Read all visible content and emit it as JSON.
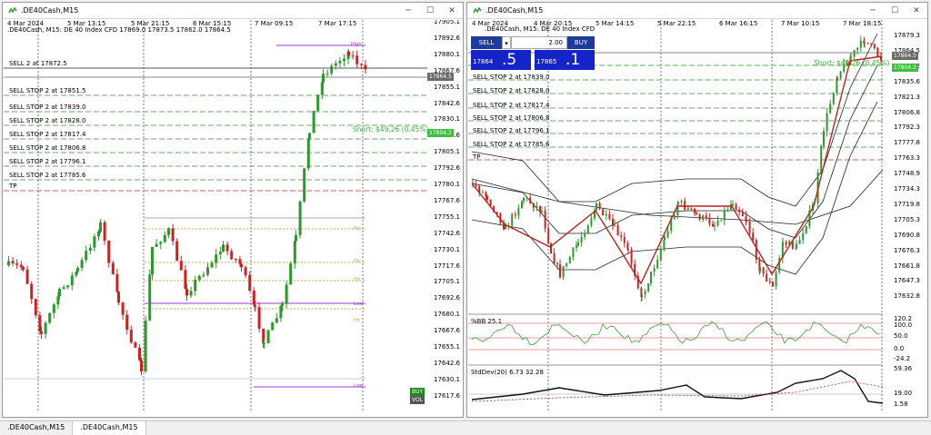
{
  "tabs": [
    ".DE40Cash,M15",
    ".DE40Cash,M15"
  ],
  "left": {
    "title": ".DE40Cash,M15",
    "info": ".DE40Cash, M15:  DE 40 Index CFD  17869.0 17873.5 17862.0 17864.5",
    "orders": [
      "SELL 2 at 17872.5",
      "SELL STOP 2 at 17851.5",
      "SELL STOP 2 at 17839.0",
      "SELL STOP 2 at 17828.0",
      "SELL STOP 2 at 17817.4",
      "SELL STOP 2 at 17806.8",
      "SELL STOP 2 at 17796.1",
      "SELL STOP 2 at 17785.6",
      "TP"
    ],
    "short_label": "Short: $49.26 (0.45%)",
    "short_badge": "17804.2",
    "price_badge": "17864.5",
    "price_axis": [
      "17905.1",
      "17892.6",
      "17880.1",
      "17867.6",
      "17855.1",
      "17842.6",
      "17830.1",
      "17817.6",
      "17805.1",
      "17792.6",
      "17780.1",
      "17767.6",
      "17755.1",
      "17742.6",
      "17730.1",
      "17717.6",
      "17705.1",
      "17692.6",
      "17680.1",
      "17667.6",
      "17655.1",
      "17642.6",
      "17630.1",
      "17617.6"
    ],
    "time_axis": [
      "4 Mar 2024",
      "5 Mar 13:15",
      "5 Mar 21:15",
      "6 Mar 15:15",
      "7 Mar 09:15",
      "7 Mar 17:15"
    ],
    "tags": [
      "High",
      "Fib",
      "Fib",
      "Fib",
      "Low",
      "Fib",
      "Low"
    ],
    "badges": [
      "BUY",
      "VOL"
    ]
  },
  "right": {
    "title": ".DE40Cash,M15",
    "info": ".DE40Cash, M15:  DE 40 Index CFD",
    "sell_label": "SELL",
    "buy_label": "BUY",
    "volume": "2.00",
    "sell_small": "17864",
    "sell_big": ".5",
    "buy_small": "17865",
    "buy_big": ".1",
    "orders": [
      "SELL STOP 2 at 17839.0",
      "SELL STOP 2 at 17828.0",
      "SELL STOP 2 at 17817.4",
      "SELL STOP 2 at 17806.8",
      "SELL STOP 2 at 17796.1",
      "SELL STOP 2 at 17785.6",
      "TP"
    ],
    "short_label": "Short: $49.26 (0.45%)",
    "short_badge": "17804.2",
    "price_badge": "17864.5",
    "price_axis": [
      "17879.3",
      "17864.5",
      "17850.2",
      "17835.6",
      "17821.3",
      "17806.8",
      "17792.3",
      "17777.8",
      "17763.3",
      "17748.9",
      "17734.3",
      "17719.8",
      "17705.3",
      "17690.8",
      "17676.3",
      "17661.8",
      "17647.3",
      "17632.8"
    ],
    "bb_label": "%BB 25.1",
    "bb_axis": [
      "120.2",
      "100.0",
      "50.0",
      "0.0",
      "-24.2"
    ],
    "sd_label": "StdDev(20) 6.73 32.28",
    "sd_axis": [
      "59.36",
      "19.00",
      "1.58"
    ],
    "time_axis": [
      "4 Mar 2024",
      "4 Mar 20:15",
      "5 Mar 14:15",
      "5 Mar 22:15",
      "6 Mar 16:15",
      "7 Mar 10:15",
      "7 Mar 18:15"
    ]
  },
  "colors": {
    "bull": "#2a9a2a",
    "bear": "#d02020",
    "purple": "#9b3bd0",
    "orange": "#e0a040",
    "sell_order": "#6aa86a",
    "tp": "#d06060"
  }
}
